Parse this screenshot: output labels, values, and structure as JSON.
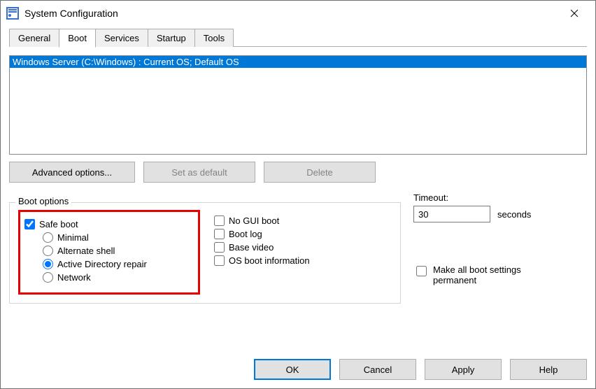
{
  "window": {
    "title": "System Configuration"
  },
  "tabs": {
    "general": "General",
    "boot": "Boot",
    "services": "Services",
    "startup": "Startup",
    "tools": "Tools",
    "active": "boot"
  },
  "os_list": {
    "items": [
      "Windows Server (C:\\Windows) : Current OS; Default OS"
    ]
  },
  "buttons": {
    "advanced": "Advanced options...",
    "set_default": "Set as default",
    "delete": "Delete"
  },
  "boot_options": {
    "legend": "Boot options",
    "safe_boot": {
      "label": "Safe boot",
      "checked": true
    },
    "safe_modes": {
      "minimal": "Minimal",
      "alt_shell": "Alternate shell",
      "ad_repair": "Active Directory repair",
      "network": "Network",
      "selected": "ad_repair"
    },
    "no_gui": {
      "label": "No GUI boot",
      "checked": false
    },
    "boot_log": {
      "label": "Boot log",
      "checked": false
    },
    "base_video": {
      "label": "Base video",
      "checked": false
    },
    "os_info": {
      "label": "OS boot information",
      "checked": false
    }
  },
  "timeout": {
    "label": "Timeout:",
    "value": "30",
    "unit": "seconds"
  },
  "permanent": {
    "label": "Make all boot settings permanent",
    "checked": false
  },
  "footer": {
    "ok": "OK",
    "cancel": "Cancel",
    "apply": "Apply",
    "help": "Help"
  }
}
